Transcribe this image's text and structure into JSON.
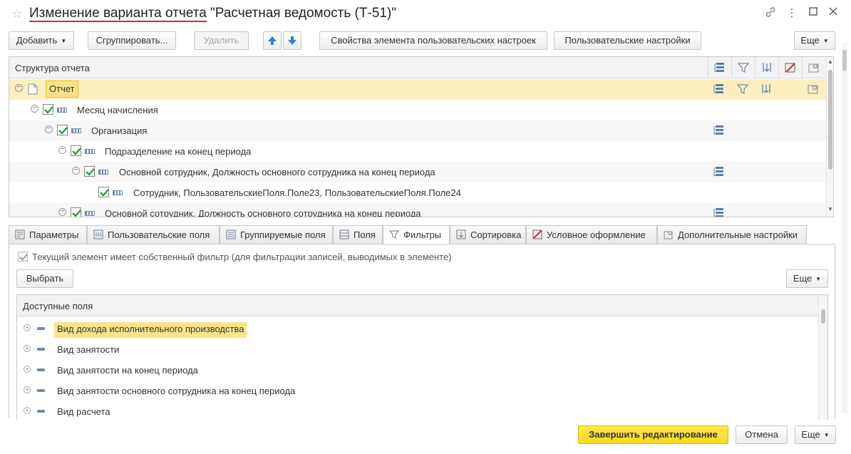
{
  "window": {
    "title_underlined": "Изменение варианта отчета",
    "title_rest": " \"Расчетная ведомость (Т-51)\""
  },
  "toolbar": {
    "add_label": "Добавить",
    "group_label": "Сгруппировать...",
    "delete_label": "Удалить",
    "element_props_label": "Свойства элемента пользовательских настроек",
    "user_settings_label": "Пользовательские настройки",
    "more_label": "Еще"
  },
  "structure": {
    "header": "Структура отчета",
    "rows": [
      {
        "label": "Отчет"
      },
      {
        "label": "Месяц начисления"
      },
      {
        "label": "Организация"
      },
      {
        "label": "Подразделение на конец периода"
      },
      {
        "label": "Основной сотрудник, Должность основного сотрудника на конец периода"
      },
      {
        "label": "Сотрудник, ПользовательскиеПоля.Поле23, ПользовательскиеПоля.Поле24"
      },
      {
        "label": "Основной сотрудник, Должность основного сотрудника на конец периода"
      }
    ]
  },
  "tabs": [
    {
      "label": "Параметры",
      "icon": "parameters-icon"
    },
    {
      "label": "Пользовательские поля",
      "icon": "user-fields-icon"
    },
    {
      "label": "Группируемые поля",
      "icon": "grouping-fields-icon"
    },
    {
      "label": "Поля",
      "icon": "fields-icon"
    },
    {
      "label": "Фильтры",
      "icon": "filter-icon",
      "active": true
    },
    {
      "label": "Сортировка",
      "icon": "sort-icon"
    },
    {
      "label": "Условное оформление",
      "icon": "conditional-format-icon"
    },
    {
      "label": "Дополнительные настройки",
      "icon": "extra-settings-icon"
    }
  ],
  "filters": {
    "own_filter_label": "Текущий элемент имеет собственный фильтр (для фильтрации записей, выводимых в элементе)",
    "select_label": "Выбрать",
    "more_label": "Еще",
    "available_header": "Доступные поля",
    "fields": [
      "Вид дохода исполнительного производства",
      "Вид занятости",
      "Вид занятости на конец периода",
      "Вид занятости основного сотрудника на конец периода",
      "Вид расчета"
    ]
  },
  "footer": {
    "finish_label": "Завершить редактирование",
    "cancel_label": "Отмена",
    "more_label": "Еще"
  },
  "colors": {
    "accent_yellow": "#f7d91c",
    "selection": "#fbefbf",
    "title_underline": "#d9252a"
  }
}
